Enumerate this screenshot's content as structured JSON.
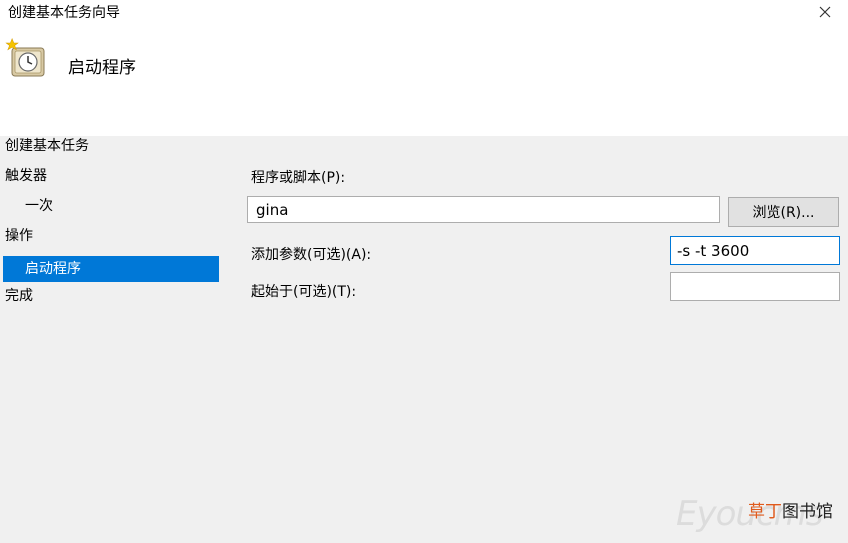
{
  "window": {
    "title": "创建基本任务向导",
    "close_glyph": "×"
  },
  "header": {
    "icon": "task-scheduler-clock-icon",
    "title": "启动程序"
  },
  "nav": {
    "items": [
      {
        "label": "创建基本任务"
      },
      {
        "label": "触发器"
      },
      {
        "label": "一次"
      },
      {
        "label": "操作"
      },
      {
        "label": "启动程序"
      },
      {
        "label": "完成"
      }
    ],
    "selected_color": "#0078d7"
  },
  "form": {
    "program_label": "程序或脚本(P):",
    "program_value": "gina",
    "browse_label": "浏览(R)...",
    "args_label": "添加参数(可选)(A):",
    "args_value": "-s -t 3600",
    "start_in_label": "起始于(可选)(T):",
    "start_in_value": ""
  },
  "watermark": {
    "letters": "Eyoucms",
    "text_accent": "草丁",
    "text_rest": "图书馆"
  }
}
